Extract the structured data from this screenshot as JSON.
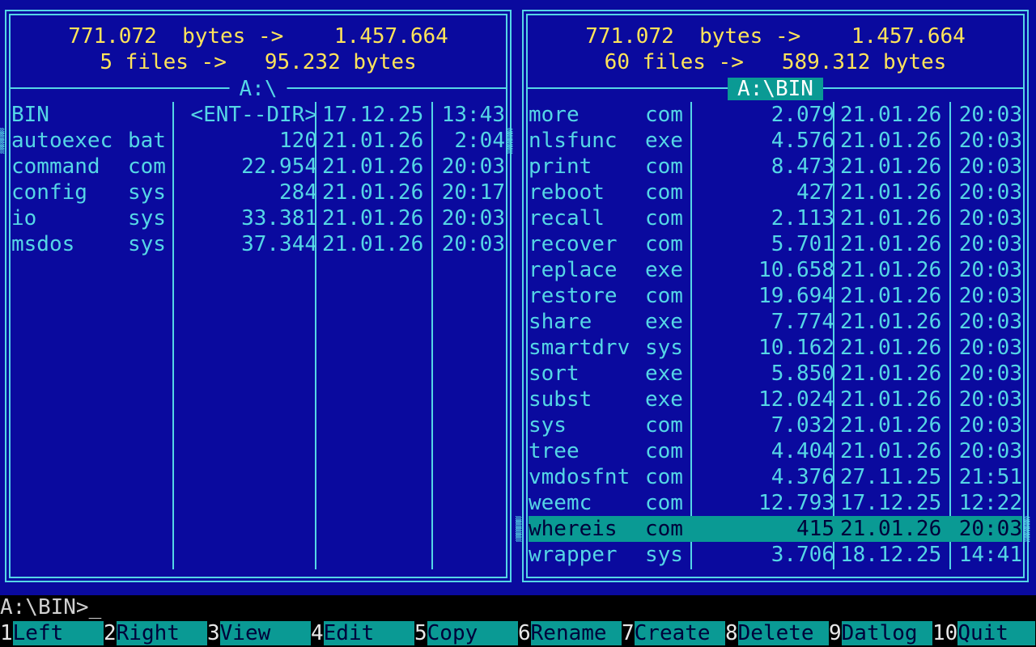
{
  "left_panel": {
    "header_line1": "771.072  bytes ->    1.457.664",
    "header_line2": "5 files ->   95.232 bytes",
    "path": "A:\\",
    "files": [
      {
        "name": "BIN",
        "ext": "",
        "size": "<ENT--DIR>",
        "date": "17.12.25",
        "time": "13:43"
      },
      {
        "name": "autoexec",
        "ext": "bat",
        "size": "120",
        "date": "21.01.26",
        "time": "2:04"
      },
      {
        "name": "command",
        "ext": "com",
        "size": "22.954",
        "date": "21.01.26",
        "time": "20:03"
      },
      {
        "name": "config",
        "ext": "sys",
        "size": "284",
        "date": "21.01.26",
        "time": "20:17"
      },
      {
        "name": "io",
        "ext": "sys",
        "size": "33.381",
        "date": "21.01.26",
        "time": "20:03"
      },
      {
        "name": "msdos",
        "ext": "sys",
        "size": "37.344",
        "date": "21.01.26",
        "time": "20:03"
      }
    ]
  },
  "right_panel": {
    "header_line1": "771.072  bytes ->    1.457.664",
    "header_line2": "60 files ->   589.312 bytes",
    "path": "A:\\BIN",
    "selected_index": 16,
    "files": [
      {
        "name": "more",
        "ext": "com",
        "size": "2.079",
        "date": "21.01.26",
        "time": "20:03"
      },
      {
        "name": "nlsfunc",
        "ext": "exe",
        "size": "4.576",
        "date": "21.01.26",
        "time": "20:03"
      },
      {
        "name": "print",
        "ext": "com",
        "size": "8.473",
        "date": "21.01.26",
        "time": "20:03"
      },
      {
        "name": "reboot",
        "ext": "com",
        "size": "427",
        "date": "21.01.26",
        "time": "20:03"
      },
      {
        "name": "recall",
        "ext": "com",
        "size": "2.113",
        "date": "21.01.26",
        "time": "20:03"
      },
      {
        "name": "recover",
        "ext": "com",
        "size": "5.701",
        "date": "21.01.26",
        "time": "20:03"
      },
      {
        "name": "replace",
        "ext": "exe",
        "size": "10.658",
        "date": "21.01.26",
        "time": "20:03"
      },
      {
        "name": "restore",
        "ext": "com",
        "size": "19.694",
        "date": "21.01.26",
        "time": "20:03"
      },
      {
        "name": "share",
        "ext": "exe",
        "size": "7.774",
        "date": "21.01.26",
        "time": "20:03"
      },
      {
        "name": "smartdrv",
        "ext": "sys",
        "size": "10.162",
        "date": "21.01.26",
        "time": "20:03"
      },
      {
        "name": "sort",
        "ext": "exe",
        "size": "5.850",
        "date": "21.01.26",
        "time": "20:03"
      },
      {
        "name": "subst",
        "ext": "exe",
        "size": "12.024",
        "date": "21.01.26",
        "time": "20:03"
      },
      {
        "name": "sys",
        "ext": "com",
        "size": "7.032",
        "date": "21.01.26",
        "time": "20:03"
      },
      {
        "name": "tree",
        "ext": "com",
        "size": "4.404",
        "date": "21.01.26",
        "time": "20:03"
      },
      {
        "name": "vmdosfnt",
        "ext": "com",
        "size": "4.376",
        "date": "27.11.25",
        "time": "21:51"
      },
      {
        "name": "weemc",
        "ext": "com",
        "size": "12.793",
        "date": "17.12.25",
        "time": "12:22"
      },
      {
        "name": "whereis",
        "ext": "com",
        "size": "415",
        "date": "21.01.26",
        "time": "20:03"
      },
      {
        "name": "wrapper",
        "ext": "sys",
        "size": "3.706",
        "date": "18.12.25",
        "time": "14:41"
      }
    ]
  },
  "command_line": "A:\\BIN>_",
  "fkeys": [
    {
      "num": "1",
      "label": "Left"
    },
    {
      "num": "2",
      "label": "Right"
    },
    {
      "num": "3",
      "label": "View"
    },
    {
      "num": "4",
      "label": "Edit"
    },
    {
      "num": "5",
      "label": "Copy"
    },
    {
      "num": "6",
      "label": "Rename"
    },
    {
      "num": "7",
      "label": "Create"
    },
    {
      "num": "8",
      "label": "Delete"
    },
    {
      "num": "9",
      "label": "Datlog"
    },
    {
      "num": "10",
      "label": "Quit"
    }
  ],
  "colors": {
    "background": "#0a0a9e",
    "frame": "#55d6e6",
    "header_text": "#ffe45a",
    "selection": "#0a9a94"
  }
}
